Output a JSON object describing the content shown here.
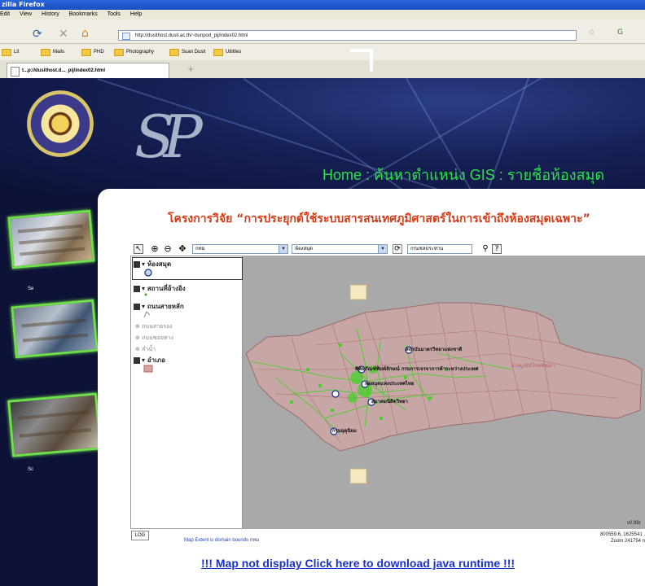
{
  "browser": {
    "title": "zilla Firefox",
    "menu": [
      "Edit",
      "View",
      "History",
      "Bookmarks",
      "Tools",
      "Help"
    ],
    "url": "http://dusithost.dusit.ac.th/~bunpod_pij/index02.html",
    "bookmarks": [
      "Lit",
      "Mails",
      "PHD",
      "Photography",
      "Suan Dusit",
      "Utilities"
    ],
    "tab_label": "t...p://dusithost.d..._pij/index02.html",
    "tab_add": "+"
  },
  "banner": {
    "logo_text": "SP",
    "nav": "Home : ค้นหาตำแหน่ง GIS : รายชื่อห้องสมุด"
  },
  "heading": "โครงการวิจัย “การประยุกต์ใช้ระบบสารสนเทศภูมิศาสตร์ในการเข้าถึงห้องสมุดเฉพาะ”",
  "left": {
    "labels": [
      "Se",
      "Sc"
    ]
  },
  "map_toolbar": {
    "combo1": "กทม",
    "combo2": "ห้องสมุด",
    "combo3": "กรมชลประทาน"
  },
  "legend": {
    "layers": [
      {
        "label": "ห้องสมุด",
        "active": true
      },
      {
        "label": "สถานที่อ้างอิง"
      },
      {
        "label": "ถนนสายหลัก"
      },
      {
        "label": "ถนนสายรอง",
        "disabled": true
      },
      {
        "label": "ถนนซอยทาง",
        "disabled": true
      },
      {
        "label": "ลำน้ำ",
        "disabled": true
      },
      {
        "label": "อำเภอ"
      }
    ]
  },
  "map": {
    "places": [
      "สถาบันมาตรวิทยาแห่งชาติ",
      "พิพิธภัณฑ์พิมพ์ลักษณ์ กรมการเจรจาการค้าระหว่างประเทศ",
      "หอสมุดแห่งประเทศไทย",
      "สมาคมนิสิตวิทยา",
      "กรมอุตุนิยม",
      "ฝ่ายมูลนิธิไทยพัฒนา"
    ],
    "version": "v0.99r",
    "colors": {
      "district_fill": "#c7a6a6",
      "district_line": "#b07070",
      "roads": "#39d41c",
      "background": "#a9a9a9"
    }
  },
  "status": {
    "logo_button": "LOG",
    "extent_text": "Map Extent is domain bounds กทม",
    "coords_line1": "800559.6, 1625541 .",
    "coords_line2": "Zoom 241754 n"
  },
  "java_link": "!!! Map not display Click here to download java runtime !!!"
}
